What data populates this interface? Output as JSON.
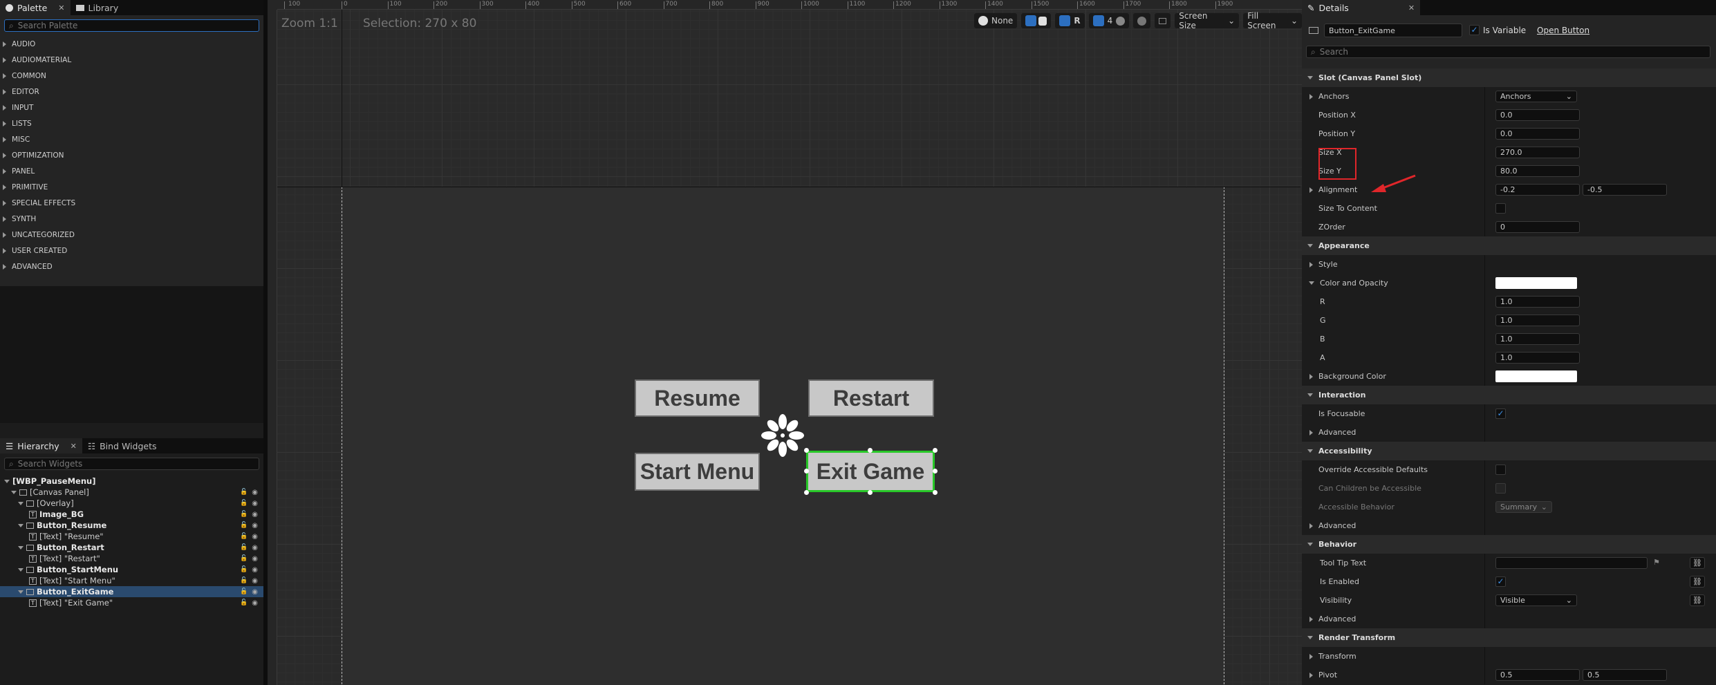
{
  "palette": {
    "tab_label": "Palette",
    "library_label": "Library",
    "search_placeholder": "Search Palette",
    "categories": [
      "AUDIO",
      "AUDIOMATERIAL",
      "COMMON",
      "EDITOR",
      "INPUT",
      "LISTS",
      "MISC",
      "OPTIMIZATION",
      "PANEL",
      "PRIMITIVE",
      "SPECIAL EFFECTS",
      "SYNTH",
      "UNCATEGORIZED",
      "USER CREATED",
      "ADVANCED"
    ]
  },
  "hierarchy": {
    "tab_label": "Hierarchy",
    "bind_label": "Bind Widgets",
    "search_placeholder": "Search Widgets",
    "items": [
      {
        "label": "[WBP_PauseMenu]"
      },
      {
        "label": "[Canvas Panel]"
      },
      {
        "label": "[Overlay]"
      },
      {
        "label": "Image_BG"
      },
      {
        "label": "Button_Resume"
      },
      {
        "label": "[Text] \"Resume\""
      },
      {
        "label": "Button_Restart"
      },
      {
        "label": "[Text] \"Restart\""
      },
      {
        "label": "Button_StartMenu"
      },
      {
        "label": "[Text] \"Start Menu\""
      },
      {
        "label": "Button_ExitGame"
      },
      {
        "label": "[Text] \"Exit Game\""
      }
    ]
  },
  "viewport": {
    "zoom": "Zoom 1:1",
    "selection": "Selection: 270 x 80",
    "toolbar": {
      "none_label": "None",
      "r_label": "R",
      "grid_count": "4",
      "screen_size": "Screen Size",
      "fill_screen": "Fill Screen"
    },
    "ruler_top": [
      "100",
      "0",
      "100",
      "200",
      "300",
      "400",
      "500",
      "600",
      "700",
      "800",
      "900",
      "1000",
      "1100",
      "1200",
      "1300",
      "1400",
      "1500",
      "1600",
      "1700",
      "1800",
      "1900"
    ],
    "buttons": {
      "resume": "Resume",
      "restart": "Restart",
      "start_menu": "Start Menu",
      "exit_game": "Exit Game"
    }
  },
  "details": {
    "tab_label": "Details",
    "widget_name": "Button_ExitGame",
    "is_variable_label": "Is Variable",
    "open_button": "Open Button",
    "search_placeholder": "Search",
    "slot_section": "Slot (Canvas Panel Slot)",
    "anchors_label": "Anchors",
    "anchors_value": "Anchors",
    "position_x_label": "Position X",
    "position_x": "0.0",
    "position_y_label": "Position Y",
    "position_y": "0.0",
    "size_x_label": "Size X",
    "size_x": "270.0",
    "size_y_label": "Size Y",
    "size_y": "80.0",
    "alignment_label": "Alignment",
    "alignment_x": "-0.2",
    "alignment_y": "-0.5",
    "size_to_content_label": "Size To Content",
    "zorder_label": "ZOrder",
    "zorder": "0",
    "appearance_section": "Appearance",
    "style_label": "Style",
    "color_opacity_label": "Color and Opacity",
    "r_label": "R",
    "r": "1.0",
    "g_label": "G",
    "g": "1.0",
    "b_label": "B",
    "b": "1.0",
    "a_label": "A",
    "a": "1.0",
    "background_color_label": "Background Color",
    "interaction_section": "Interaction",
    "is_focusable_label": "Is Focusable",
    "advanced_label": "Advanced",
    "accessibility_section": "Accessibility",
    "override_label": "Override Accessible Defaults",
    "can_children_label": "Can Children be Accessible",
    "accessible_behavior_label": "Accessible Behavior",
    "accessible_behavior_value": "Summary",
    "behavior_section": "Behavior",
    "tooltip_label": "Tool Tip Text",
    "is_enabled_label": "Is Enabled",
    "visibility_label": "Visibility",
    "visibility_value": "Visible",
    "render_transform_section": "Render Transform",
    "transform_label": "Transform",
    "pivot_label": "Pivot",
    "pivot_x": "0.5",
    "pivot_y": "0.5"
  },
  "colors": {
    "accent": "#2c6fc0",
    "selection_green": "#28c828",
    "annotation_red": "#e0262a"
  }
}
